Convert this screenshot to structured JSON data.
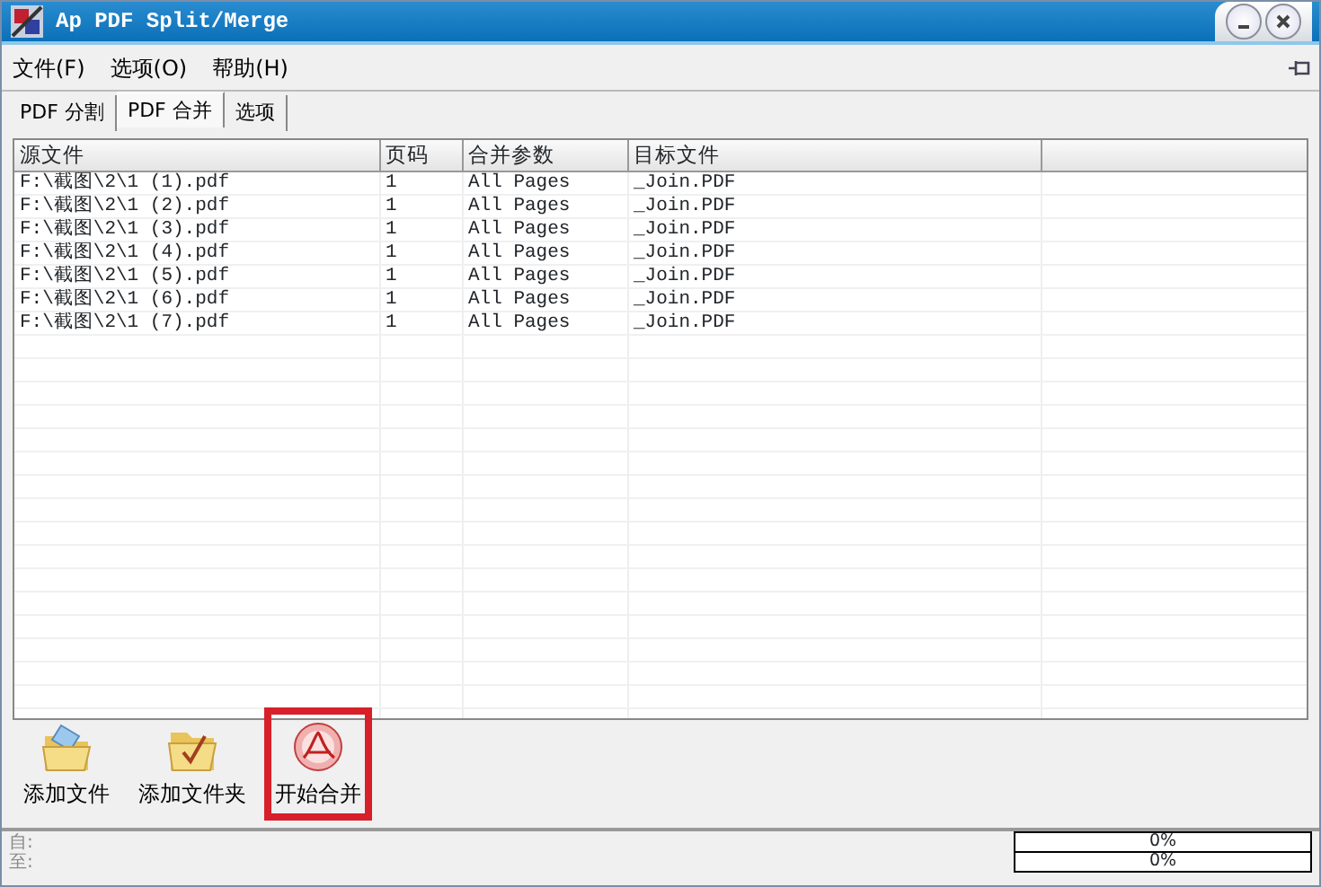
{
  "window": {
    "title": "Ap PDF Split/Merge"
  },
  "menu": [
    "文件(F)",
    "选项(O)",
    "帮助(H)"
  ],
  "tabs": [
    {
      "label": "PDF 分割",
      "selected": false
    },
    {
      "label": "PDF 合并",
      "selected": true
    },
    {
      "label": "选项",
      "selected": false
    }
  ],
  "table": {
    "columns": [
      "源文件",
      "页码",
      "合并参数",
      "目标文件",
      ""
    ],
    "rows": [
      [
        "F:\\截图\\2\\1 (1).pdf",
        "1",
        "All Pages",
        "_Join.PDF"
      ],
      [
        "F:\\截图\\2\\1 (2).pdf",
        "1",
        "All Pages",
        "_Join.PDF"
      ],
      [
        "F:\\截图\\2\\1 (3).pdf",
        "1",
        "All Pages",
        "_Join.PDF"
      ],
      [
        "F:\\截图\\2\\1 (4).pdf",
        "1",
        "All Pages",
        "_Join.PDF"
      ],
      [
        "F:\\截图\\2\\1 (5).pdf",
        "1",
        "All Pages",
        "_Join.PDF"
      ],
      [
        "F:\\截图\\2\\1 (6).pdf",
        "1",
        "All Pages",
        "_Join.PDF"
      ],
      [
        "F:\\截图\\2\\1 (7).pdf",
        "1",
        "All Pages",
        "_Join.PDF"
      ]
    ]
  },
  "toolbar": [
    {
      "label": "添加文件",
      "kind": "file",
      "highlighted": false
    },
    {
      "label": "添加文件夹",
      "kind": "folder",
      "highlighted": false
    },
    {
      "label": "开始合并",
      "kind": "merge",
      "highlighted": true
    }
  ],
  "status_bar": {
    "labels": [
      "自:",
      "至:"
    ],
    "progress": [
      {
        "reading": "0%",
        "level": 0
      },
      {
        "reading": "0%",
        "level": 0
      }
    ]
  }
}
